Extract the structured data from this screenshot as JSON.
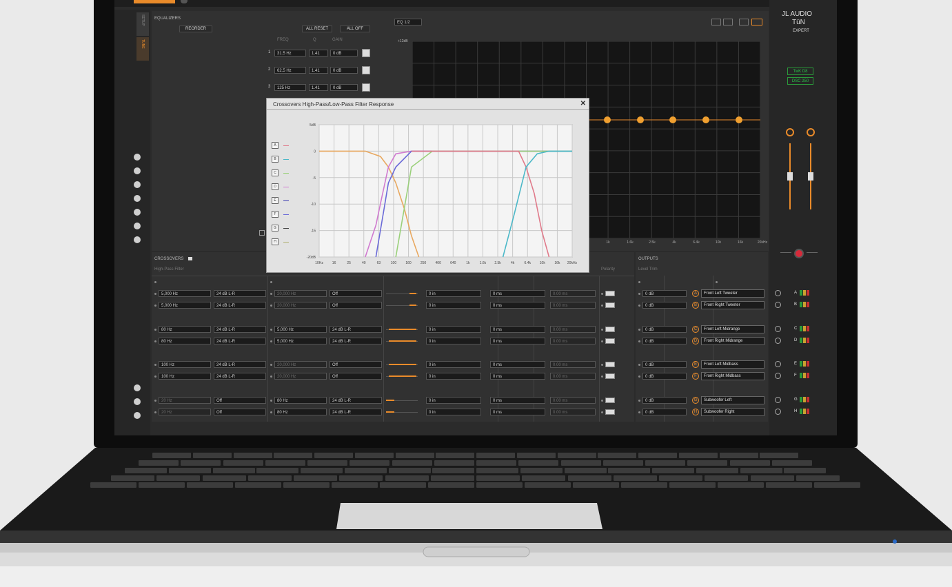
{
  "app": {
    "brand_line1": "JL AUDIO",
    "brand_line2": "TüN",
    "brand_line3": "EXPERT",
    "hw_badge1": "TwK D8",
    "hw_badge2": "DSC 250",
    "side_tab_setup": "SETUP",
    "side_tab_tune": "TUNE",
    "accent": "#ea8b2a"
  },
  "equalizers": {
    "title": "EQUALIZERS",
    "reorder": "REORDER",
    "all_reset": "ALL RESET",
    "all_off": "ALL OFF",
    "col_freq": "FREQ",
    "col_q": "Q",
    "col_gain": "GAIN",
    "eq_select": "EQ 1/2",
    "rows": [
      {
        "num": "1",
        "freq": "31.5 Hz",
        "q": "1.41",
        "gain": "0 dB"
      },
      {
        "num": "2",
        "freq": "62.5 Hz",
        "q": "1.41",
        "gain": "0 dB"
      },
      {
        "num": "3",
        "freq": "125 Hz",
        "q": "1.41",
        "gain": "0 dB"
      }
    ],
    "graph_top_label": "+12dB",
    "x_ticks": [
      "1k",
      "1.6k",
      "2.5k",
      "4k",
      "6.4k",
      "10k",
      "16k",
      "20kHz"
    ]
  },
  "crossovers": {
    "title": "CROSSOVERS",
    "hp_label": "High-Pass Filter",
    "polarity_label": "Polarity",
    "rows": [
      {
        "hp_freq": "5,000 Hz",
        "hp_slope": "24 dB L-R",
        "lp_freq": "20,000 Hz",
        "lp_slope": "Off",
        "delay_in": "0 in",
        "delay_ms": "0 ms",
        "delay_val": "0.00 ms"
      },
      {
        "hp_freq": "5,000 Hz",
        "hp_slope": "24 dB L-R",
        "lp_freq": "20,000 Hz",
        "lp_slope": "Off",
        "delay_in": "0 in",
        "delay_ms": "0 ms",
        "delay_val": "0.00 ms"
      },
      {
        "hp_freq": "80 Hz",
        "hp_slope": "24 dB L-R",
        "lp_freq": "5,000 Hz",
        "lp_slope": "24 dB L-R",
        "delay_in": "0 in",
        "delay_ms": "0 ms",
        "delay_val": "0.00 ms"
      },
      {
        "hp_freq": "80 Hz",
        "hp_slope": "24 dB L-R",
        "lp_freq": "5,000 Hz",
        "lp_slope": "24 dB L-R",
        "delay_in": "0 in",
        "delay_ms": "0 ms",
        "delay_val": "0.00 ms"
      },
      {
        "hp_freq": "100 Hz",
        "hp_slope": "24 dB L-R",
        "lp_freq": "20,000 Hz",
        "lp_slope": "Off",
        "delay_in": "0 in",
        "delay_ms": "0 ms",
        "delay_val": "0.00 ms"
      },
      {
        "hp_freq": "100 Hz",
        "hp_slope": "24 dB L-R",
        "lp_freq": "20,000 Hz",
        "lp_slope": "Off",
        "delay_in": "0 in",
        "delay_ms": "0 ms",
        "delay_val": "0.00 ms"
      },
      {
        "hp_freq": "20 Hz",
        "hp_slope": "Off",
        "lp_freq": "80 Hz",
        "lp_slope": "24 dB L-R",
        "delay_in": "0 in",
        "delay_ms": "0 ms",
        "delay_val": "0.00 ms"
      },
      {
        "hp_freq": "20 Hz",
        "hp_slope": "Off",
        "lp_freq": "80 Hz",
        "lp_slope": "24 dB L-R",
        "delay_in": "0 in",
        "delay_ms": "0 ms",
        "delay_val": "0.00 ms"
      }
    ]
  },
  "outputs": {
    "title": "OUTPUTS",
    "level_label": "Level Trim",
    "rows": [
      {
        "level": "0 dB",
        "ch": "A",
        "name": "Front Left Tweeter"
      },
      {
        "level": "0 dB",
        "ch": "B",
        "name": "Front Right Tweeter"
      },
      {
        "level": "0 dB",
        "ch": "C",
        "name": "Front Left Midrange"
      },
      {
        "level": "0 dB",
        "ch": "D",
        "name": "Front Right Midrange"
      },
      {
        "level": "0 dB",
        "ch": "E",
        "name": "Front Left Midbass"
      },
      {
        "level": "0 dB",
        "ch": "F",
        "name": "Front Right Midbass"
      },
      {
        "level": "0 dB",
        "ch": "G",
        "name": "Subwoofer Left"
      },
      {
        "level": "0 dB",
        "ch": "H",
        "name": "Subwoofer Right"
      }
    ]
  },
  "dialog": {
    "title": "Crossovers High-Pass/Low-Pass Filter Response",
    "close": "✕",
    "legend": [
      {
        "ch": "A",
        "color": "#e07a8a"
      },
      {
        "ch": "B",
        "color": "#4bb8c8"
      },
      {
        "ch": "C",
        "color": "#9ad07a"
      },
      {
        "ch": "D",
        "color": "#d07ad0"
      },
      {
        "ch": "E",
        "color": "#3a3ab0"
      },
      {
        "ch": "F",
        "color": "#6a6ad8"
      },
      {
        "ch": "G",
        "color": "#444444"
      },
      {
        "ch": "H",
        "color": "#b0b070"
      }
    ]
  },
  "chart_data": {
    "type": "line",
    "title": "Crossovers High-Pass/Low-Pass Filter Response",
    "xlabel": "",
    "ylabel": "",
    "x_scale": "log",
    "x_tick_labels": [
      "10Hz",
      "16",
      "25",
      "40",
      "63",
      "100",
      "160",
      "250",
      "400",
      "640",
      "1k",
      "1.6k",
      "2.5k",
      "4k",
      "6.4k",
      "10k",
      "16k",
      "20kHz"
    ],
    "y_tick_labels": [
      "5dB",
      "0",
      "-5",
      "-10",
      "-15",
      "-20dB"
    ],
    "ylim": [
      -20,
      5
    ],
    "xlim": [
      10,
      20000
    ],
    "series": [
      {
        "color": "#e8a860",
        "x": [
          10,
          40,
          63,
          80,
          100,
          130,
          160,
          200
        ],
        "y": [
          0,
          0,
          -1,
          -3,
          -6,
          -11,
          -16,
          -20
        ]
      },
      {
        "color": "#d07ad0",
        "x": [
          40,
          55,
          65,
          80,
          100,
          160,
          20000
        ],
        "y": [
          -20,
          -14,
          -9,
          -3,
          -0.5,
          0,
          0
        ]
      },
      {
        "color": "#6a6ad8",
        "x": [
          55,
          70,
          80,
          100,
          160,
          20000
        ],
        "y": [
          -20,
          -11,
          -6,
          -3,
          0,
          0
        ]
      },
      {
        "color": "#9ad07a",
        "x": [
          100,
          160,
          300,
          20000
        ],
        "y": [
          -20,
          -3,
          0,
          0
        ]
      },
      {
        "color": "#e07a8a",
        "x": [
          160,
          400,
          1000,
          4000,
          5000,
          6400,
          8000,
          10000
        ],
        "y": [
          0,
          0,
          0,
          0,
          -3,
          -8,
          -15,
          -20
        ]
      },
      {
        "color": "#4bb8c8",
        "x": [
          2500,
          3500,
          5000,
          7000,
          10000,
          20000
        ],
        "y": [
          -20,
          -12,
          -3,
          -0.5,
          0,
          0
        ]
      }
    ]
  }
}
